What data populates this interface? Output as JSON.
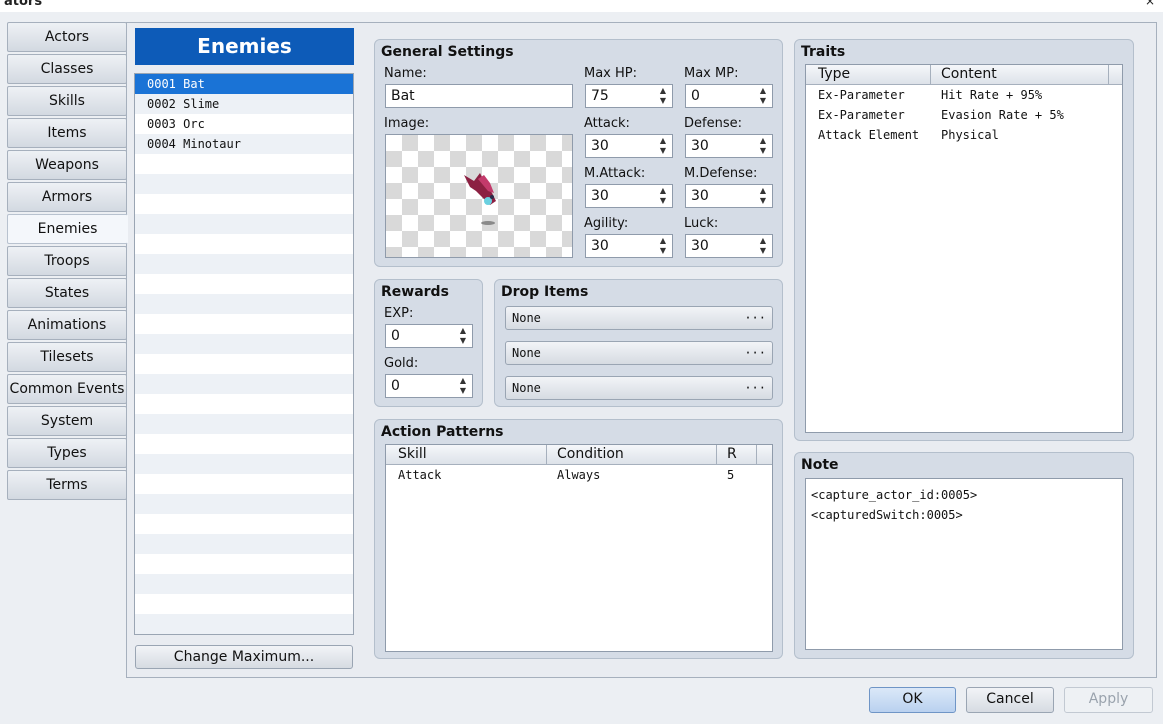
{
  "window": {
    "title": "ators",
    "close_glyph": "×"
  },
  "sidebar": {
    "items": [
      "Actors",
      "Classes",
      "Skills",
      "Items",
      "Weapons",
      "Armors",
      "Enemies",
      "Troops",
      "States",
      "Animations",
      "Tilesets",
      "Common Events",
      "System",
      "Types",
      "Terms"
    ],
    "active": "Enemies"
  },
  "enemy_list": {
    "header": "Enemies",
    "items": [
      "0001 Bat",
      "0002 Slime",
      "0003 Orc",
      "0004 Minotaur"
    ],
    "selected": "0001 Bat",
    "change_max_label": "Change Maximum..."
  },
  "general": {
    "title": "General Settings",
    "name_label": "Name:",
    "name_value": "Bat",
    "image_label": "Image:",
    "maxhp_label": "Max HP:",
    "maxhp": "75",
    "maxmp_label": "Max MP:",
    "maxmp": "0",
    "attack_label": "Attack:",
    "attack": "30",
    "defense_label": "Defense:",
    "defense": "30",
    "mattack_label": "M.Attack:",
    "mattack": "30",
    "mdefense_label": "M.Defense:",
    "mdefense": "30",
    "agility_label": "Agility:",
    "agility": "30",
    "luck_label": "Luck:",
    "luck": "30"
  },
  "rewards": {
    "title": "Rewards",
    "exp_label": "EXP:",
    "exp": "0",
    "gold_label": "Gold:",
    "gold": "0"
  },
  "drop_items": {
    "title": "Drop Items",
    "items": [
      "None",
      "None",
      "None"
    ],
    "more": "···"
  },
  "action_patterns": {
    "title": "Action Patterns",
    "columns": [
      "Skill",
      "Condition",
      "R"
    ],
    "rows": [
      {
        "skill": "Attack",
        "condition": "Always",
        "r": "5"
      }
    ]
  },
  "traits": {
    "title": "Traits",
    "columns": [
      "Type",
      "Content"
    ],
    "rows": [
      {
        "type": "Ex-Parameter",
        "content": "Hit Rate + 95%"
      },
      {
        "type": "Ex-Parameter",
        "content": "Evasion Rate + 5%"
      },
      {
        "type": "Attack Element",
        "content": "Physical"
      }
    ]
  },
  "note": {
    "title": "Note",
    "lines": [
      "<capture_actor_id:0005>",
      "<capturedSwitch:0005>"
    ]
  },
  "footer": {
    "ok": "OK",
    "cancel": "Cancel",
    "apply": "Apply"
  },
  "colors": {
    "accent": "#0d5bb8",
    "selection": "#1a73d6",
    "panel": "#d5dce6"
  }
}
